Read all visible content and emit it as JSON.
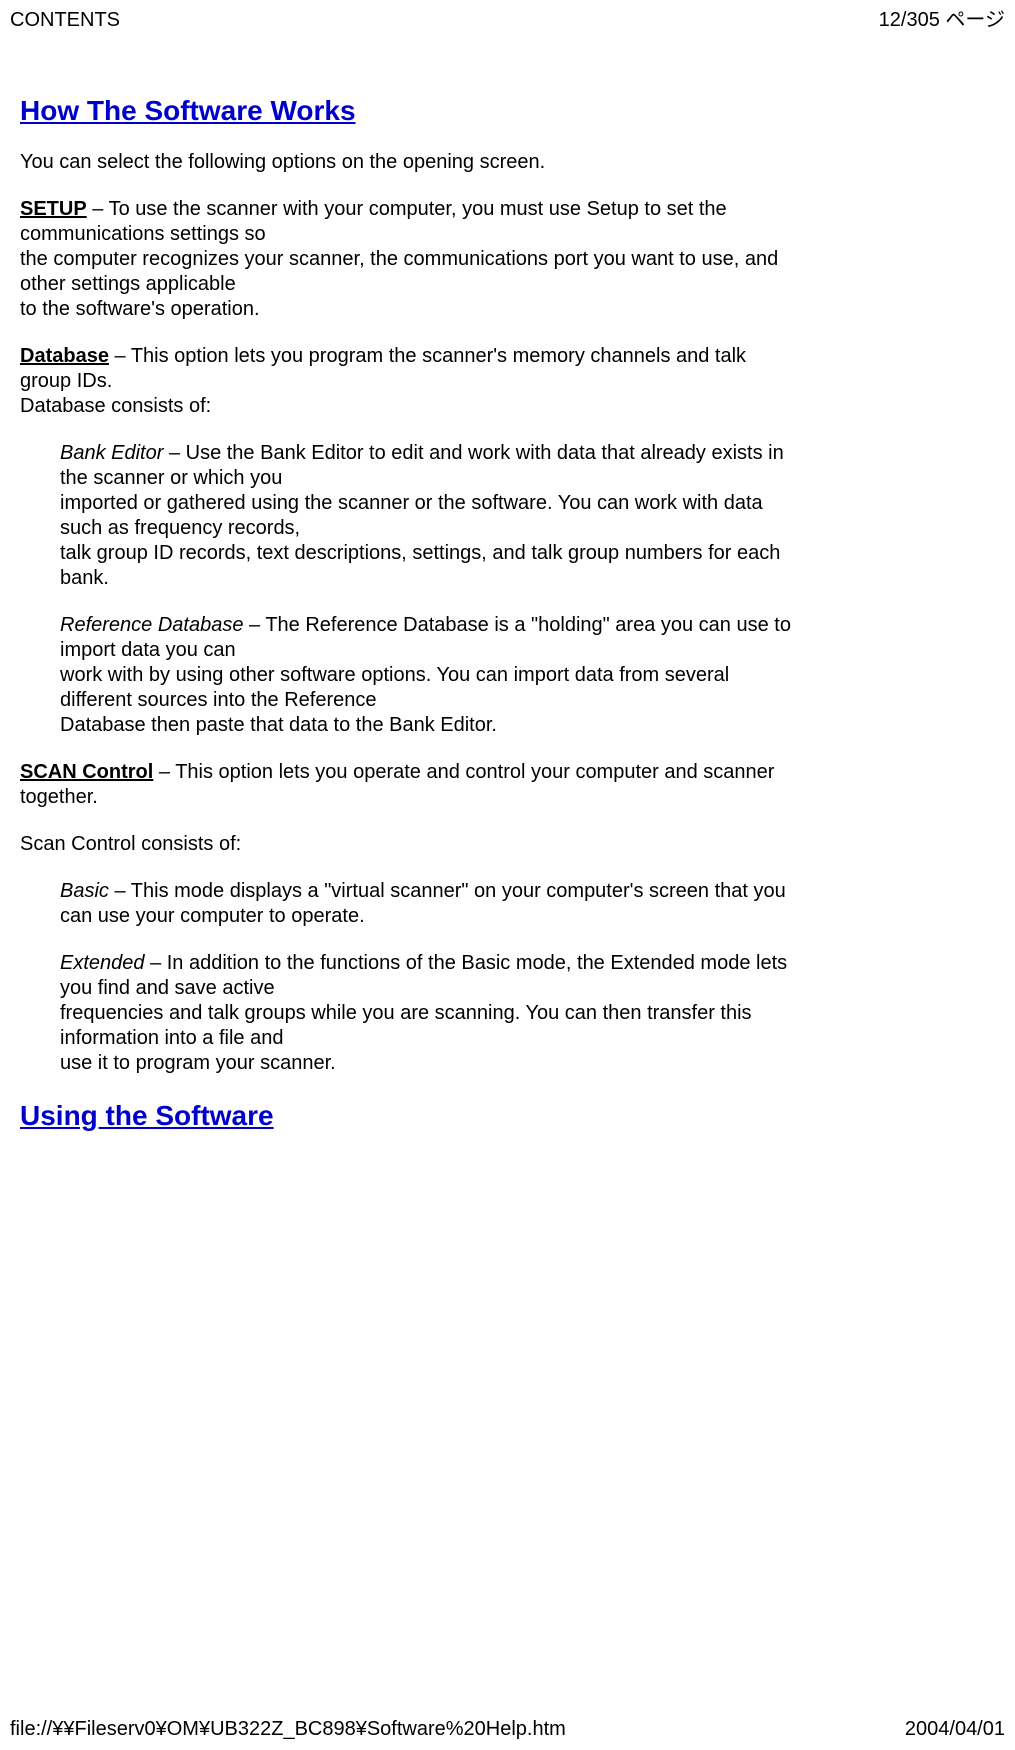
{
  "header": {
    "left": "CONTENTS",
    "right": "12/305 ページ"
  },
  "sections": {
    "howWorks": {
      "title": "How The Software Works",
      "intro": "You can select the following options on the opening screen.",
      "setup": {
        "label": "SETUP",
        "line1": " – To use the scanner with your computer, you must use Setup to set the communications settings so",
        "line2": "the computer recognizes your scanner, the communications port you want to use, and other settings applicable",
        "line3": "to the software's operation."
      },
      "database": {
        "label": "Database",
        "line1": " – This option lets you program the scanner's memory channels and talk group IDs.",
        "line2": "Database consists of:",
        "bankEditor": {
          "label": "Bank Editor",
          "line1": " – Use the Bank Editor to edit and work with data that already exists in the scanner or which you",
          "line2": "imported or gathered using the scanner or the software. You can work with data such as frequency records,",
          "line3": "talk group ID records, text descriptions, settings, and talk group numbers for each bank."
        },
        "referenceDb": {
          "label": "Reference Database",
          "line1": " – The Reference Database is a \"holding\" area you can use to import data you can",
          "line2": "work with by using other software options. You can import data from several different sources into the Reference",
          "line3": "Database then paste that data to the Bank Editor."
        }
      },
      "scanControl": {
        "label": "SCAN Control",
        "line1": " – This option lets you operate and control your computer and scanner together.",
        "consists": "Scan Control consists of:",
        "basic": {
          "label": "Basic",
          "line1": " – This mode displays a \"virtual scanner\" on your computer's screen that you can use your computer to operate."
        },
        "extended": {
          "label": "Extended",
          "line1": " – In addition to the functions of the Basic mode, the Extended mode lets you find and save active",
          "line2": "frequencies and talk groups while you are scanning.  You can then transfer this information into a file and",
          "line3": "use it to program your scanner."
        }
      }
    },
    "usingSoftware": {
      "title": "Using the Software"
    }
  },
  "footer": {
    "path": "file://¥¥Fileserv0¥OM¥UB322Z_BC898¥Software%20Help.htm",
    "date": "2004/04/01"
  }
}
